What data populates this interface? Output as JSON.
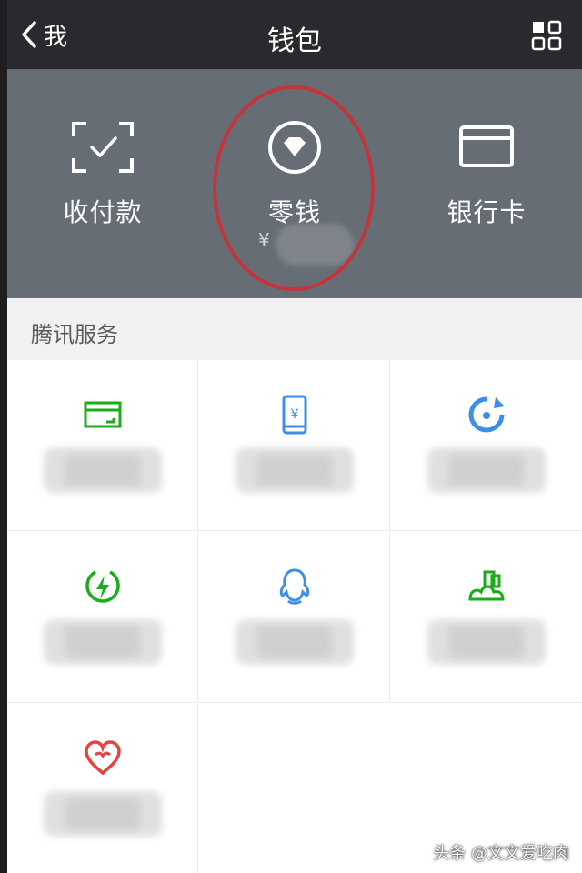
{
  "nav": {
    "back_label": "我",
    "title": "钱包"
  },
  "actions": {
    "pay": {
      "label": "收付款",
      "icon": "scan-qr-icon"
    },
    "change": {
      "label": "零钱",
      "icon": "diamond-coin-icon",
      "balance_prefix": "¥"
    },
    "card": {
      "label": "银行卡",
      "icon": "bank-card-icon"
    }
  },
  "section": {
    "title": "腾讯服务"
  },
  "services": [
    {
      "icon": "credit-card-repay-icon",
      "color": "#1aad19"
    },
    {
      "icon": "phone-topup-icon",
      "color": "#3c8ee6"
    },
    {
      "icon": "financial-spin-icon",
      "color": "#3c8ee6"
    },
    {
      "icon": "utility-lightning-icon",
      "color": "#1aad19"
    },
    {
      "icon": "qq-penguin-icon",
      "color": "#3c8ee6"
    },
    {
      "icon": "city-service-icon",
      "color": "#1aad19"
    },
    {
      "icon": "charity-heart-icon",
      "color": "#e64340"
    }
  ],
  "watermark": "头条 @文文爱吃肉",
  "colors": {
    "navbar": "#2a2a2e",
    "panel": "#676d75",
    "highlight_circle": "#c3353b"
  }
}
